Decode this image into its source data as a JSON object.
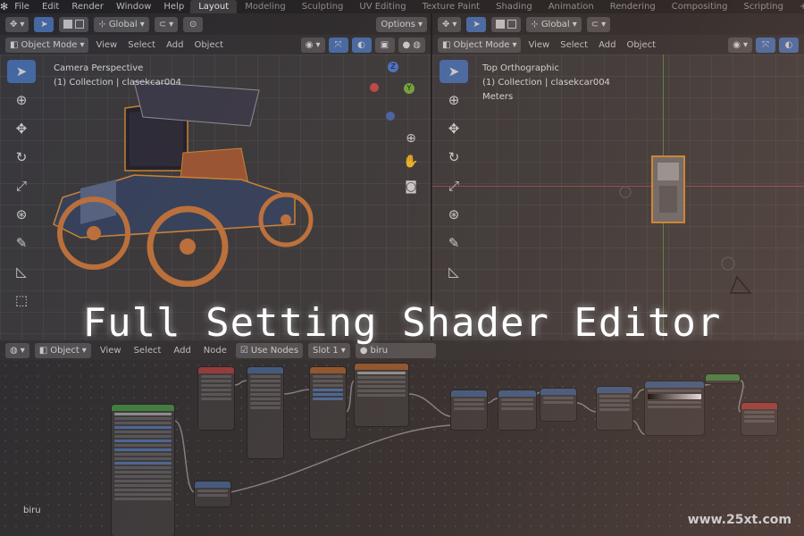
{
  "topbar": {
    "menus": [
      "File",
      "Edit",
      "Render",
      "Window",
      "Help"
    ],
    "workspaces": [
      "Layout",
      "Modeling",
      "Sculpting",
      "UV Editing",
      "Texture Paint",
      "Shading",
      "Animation",
      "Rendering",
      "Compositing",
      "Scripting"
    ],
    "active_workspace": "Layout",
    "add_tab": "+"
  },
  "left_view": {
    "mode": "Object Mode",
    "menus": [
      "View",
      "Select",
      "Add",
      "Object"
    ],
    "transform": "Global",
    "options": "Options",
    "title": "Camera Perspective",
    "collection": "(1) Collection | clasekcar004"
  },
  "right_view": {
    "mode": "Object Mode",
    "menus": [
      "View",
      "Select",
      "Add",
      "Object"
    ],
    "transform": "Global",
    "title": "Top Orthographic",
    "collection": "(1) Collection | clasekcar004",
    "units": "Meters"
  },
  "gizmo": {
    "x": "X",
    "y": "Y",
    "z": "Z"
  },
  "shader_editor": {
    "object_type": "Object",
    "menus": [
      "View",
      "Select",
      "Add",
      "Node"
    ],
    "use_nodes": "Use Nodes",
    "slot": "Slot 1",
    "material": "biru",
    "material_label": "biru"
  },
  "overlay": {
    "title": "Full Setting Shader Editor",
    "watermark": "www.25xt.com"
  },
  "colors": {
    "accent": "#4772b3",
    "header_green": "#3f8a3f",
    "header_red": "#a03a3a",
    "header_blue": "#3f5f8a",
    "header_orange": "#9a5a2a"
  }
}
